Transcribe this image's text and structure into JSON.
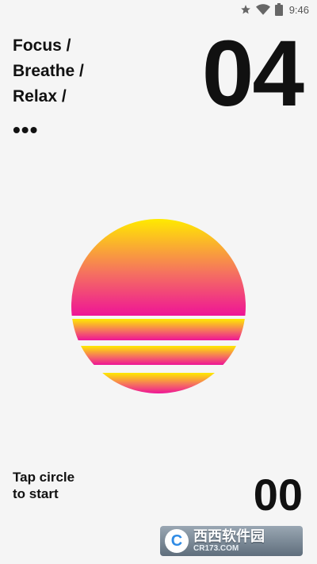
{
  "status_bar": {
    "time": "9:46",
    "icons": [
      "star-icon",
      "wifi-icon",
      "battery-icon"
    ]
  },
  "modes": [
    "Focus /",
    "Breathe /",
    "Relax /"
  ],
  "more_label": "•••",
  "timer": {
    "minutes": "04",
    "seconds": "00"
  },
  "hint": "Tap circle to start",
  "sun_colors": {
    "top": "#FFEA00",
    "middle": "#F5735E",
    "bottom": "#EE1497"
  },
  "watermark": {
    "badge": "C",
    "main": "西西软件园",
    "sub": "CR173.COM"
  }
}
